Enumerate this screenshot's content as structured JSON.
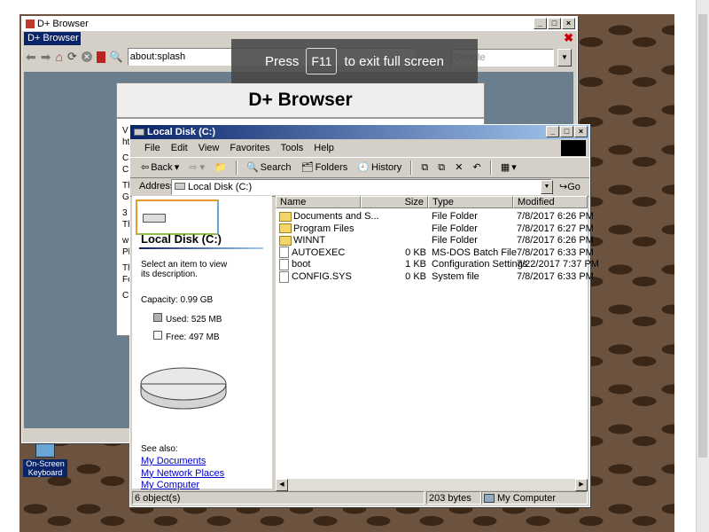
{
  "browser": {
    "title": "D+ Browser",
    "tab": "D+ Browser",
    "address": "about:splash",
    "search_placeholder": "Google",
    "fullscreen_press": "Press",
    "fullscreen_key": "F11",
    "fullscreen_rest": "to exit full screen",
    "page_heading": "D+ Browser",
    "page_fragments": [
      "V",
      "ht",
      "C",
      "C",
      "Th",
      "G",
      "3",
      "Th",
      "w",
      "Pl",
      "Th",
      "Fo",
      "C"
    ]
  },
  "explorer": {
    "title": "Local Disk (C:)",
    "menu": [
      "File",
      "Edit",
      "View",
      "Favorites",
      "Tools",
      "Help"
    ],
    "toolbar": {
      "back": "Back",
      "search": "Search",
      "folders": "Folders",
      "history": "History"
    },
    "address_label": "Address",
    "address_value": "Local Disk (C:)",
    "go": "Go",
    "left_panel": {
      "heading": "Local Disk (C:)",
      "hint": "Select an item to view its description.",
      "capacity": "Capacity: 0.99 GB",
      "used": "Used: 525 MB",
      "free": "Free: 497 MB",
      "see_also": "See also:",
      "links": [
        "My Documents",
        "My Network Places",
        "My Computer"
      ]
    },
    "columns": [
      "Name",
      "Size",
      "Type",
      "Modified"
    ],
    "files": [
      {
        "name": "Documents and S...",
        "size": "",
        "type": "File Folder",
        "modified": "7/8/2017 6:26 PM",
        "kind": "folder"
      },
      {
        "name": "Program Files",
        "size": "",
        "type": "File Folder",
        "modified": "7/8/2017 6:27 PM",
        "kind": "folder"
      },
      {
        "name": "WINNT",
        "size": "",
        "type": "File Folder",
        "modified": "7/8/2017 6:26 PM",
        "kind": "folder"
      },
      {
        "name": "AUTOEXEC",
        "size": "0 KB",
        "type": "MS-DOS Batch File",
        "modified": "7/8/2017 6:33 PM",
        "kind": "file"
      },
      {
        "name": "boot",
        "size": "1 KB",
        "type": "Configuration Settings",
        "modified": "7/22/2017 7:37 PM",
        "kind": "file"
      },
      {
        "name": "CONFIG.SYS",
        "size": "0 KB",
        "type": "System file",
        "modified": "7/8/2017 6:33 PM",
        "kind": "file"
      }
    ],
    "status": {
      "objects": "6 object(s)",
      "bytes": "203 bytes",
      "location": "My Computer"
    }
  },
  "desktop_icon": {
    "label_line1": "On-Screen",
    "label_line2": "Keyboard"
  }
}
